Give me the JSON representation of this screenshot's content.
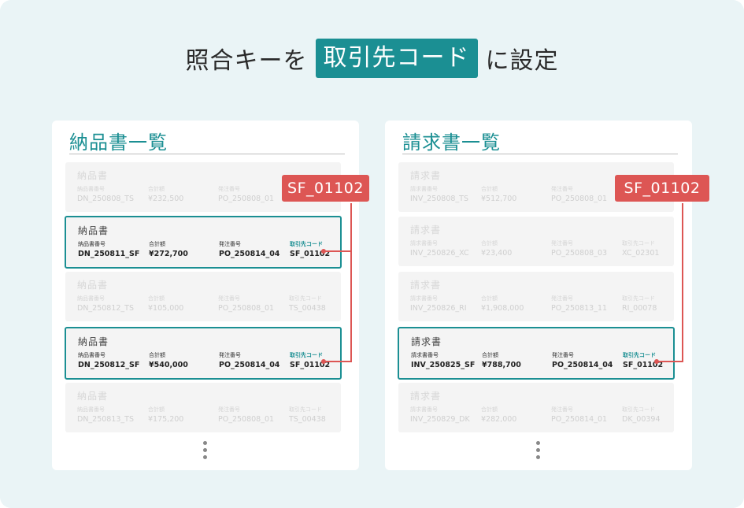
{
  "title": {
    "before": "照合キーを",
    "highlight": "取引先コード",
    "after": "に設定"
  },
  "colors": {
    "accent": "#1b8f93",
    "callout": "#dd5654",
    "background": "#eaf4f6"
  },
  "left_panel": {
    "title": "納品書一覧",
    "callout": "SF_01102",
    "cards": [
      {
        "title": "納品書",
        "l1": "納品書番号",
        "l2": "合計額",
        "l3": "発注番号",
        "l4": "",
        "v1": "DN_250808_TS",
        "v2": "¥232,500",
        "v3": "PO_250808_01",
        "v4": ""
      },
      {
        "title": "納品書",
        "l1": "納品書番号",
        "l2": "合計額",
        "l3": "発注番号",
        "l4": "取引先コード",
        "v1": "DN_250811_SF",
        "v2": "¥272,700",
        "v3": "PO_250814_04",
        "v4": "SF_01102"
      },
      {
        "title": "納品書",
        "l1": "納品書番号",
        "l2": "合計額",
        "l3": "発注番号",
        "l4": "取引先コード",
        "v1": "DN_250812_TS",
        "v2": "¥105,000",
        "v3": "PO_250808_01",
        "v4": "TS_00438"
      },
      {
        "title": "納品書",
        "l1": "納品書番号",
        "l2": "合計額",
        "l3": "発注番号",
        "l4": "取引先コード",
        "v1": "DN_250812_SF",
        "v2": "¥540,000",
        "v3": "PO_250814_04",
        "v4": "SF_01102"
      },
      {
        "title": "納品書",
        "l1": "納品書番号",
        "l2": "合計額",
        "l3": "発注番号",
        "l4": "取引先コード",
        "v1": "DN_250813_TS",
        "v2": "¥175,200",
        "v3": "PO_250808_01",
        "v4": "TS_00438"
      }
    ]
  },
  "right_panel": {
    "title": "請求書一覧",
    "callout": "SF_01102",
    "cards": [
      {
        "title": "請求書",
        "l1": "請求書番号",
        "l2": "合計額",
        "l3": "発注番号",
        "l4": "",
        "v1": "INV_250808_TS",
        "v2": "¥512,700",
        "v3": "PO_250808_01",
        "v4": ""
      },
      {
        "title": "請求書",
        "l1": "請求書番号",
        "l2": "合計額",
        "l3": "発注番号",
        "l4": "取引先コード",
        "v1": "INV_250826_XC",
        "v2": "¥23,400",
        "v3": "PO_250808_03",
        "v4": "XC_02301"
      },
      {
        "title": "請求書",
        "l1": "請求書番号",
        "l2": "合計額",
        "l3": "発注番号",
        "l4": "取引先コード",
        "v1": "INV_250826_RI",
        "v2": "¥1,908,000",
        "v3": "PO_250813_11",
        "v4": "RI_00078"
      },
      {
        "title": "請求書",
        "l1": "請求書番号",
        "l2": "合計額",
        "l3": "発注番号",
        "l4": "取引先コード",
        "v1": "INV_250825_SF",
        "v2": "¥788,700",
        "v3": "PO_250814_04",
        "v4": "SF_01102"
      },
      {
        "title": "請求書",
        "l1": "請求書番号",
        "l2": "合計額",
        "l3": "発注番号",
        "l4": "取引先コード",
        "v1": "INV_250829_DK",
        "v2": "¥282,000",
        "v3": "PO_250814_01",
        "v4": "DK_00394"
      }
    ]
  }
}
